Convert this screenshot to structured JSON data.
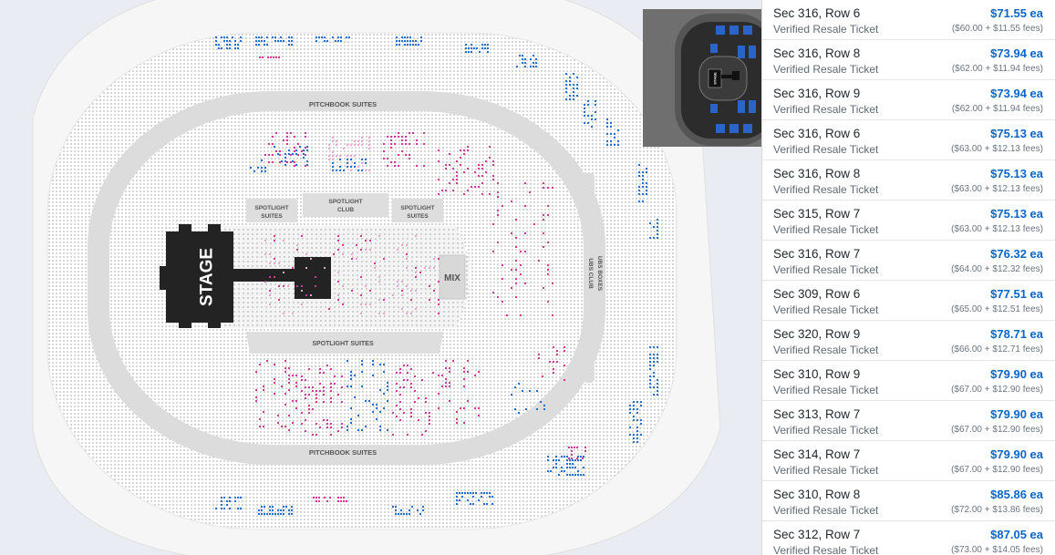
{
  "map": {
    "stage_label": "STAGE",
    "mix_label": "MIX",
    "pitchbook_top_label": "PITCHBOOK SUITES",
    "pitchbook_bottom_label": "PITCHBOOK SUITES",
    "spotlight_suites_left_label": [
      "SPOTLIGHT",
      "SUITES"
    ],
    "spotlight_club_label": [
      "SPOTLIGHT",
      "CLUB"
    ],
    "spotlight_suites_right_label": [
      "SPOTLIGHT",
      "SUITES"
    ],
    "spotlight_suites_bottom_label": "SPOTLIGHT SUITES",
    "ubs_club_label": [
      "UBS CLUB",
      "UBS BOXES"
    ],
    "colors": {
      "available_blue": "#1f6fd1",
      "available_pink": "#d2389a",
      "light_pink": "#e8a6cf",
      "seat_grey": "#c9c9c9",
      "suite_ring": "#d9d9d9",
      "stage": "#222222"
    }
  },
  "minimap": {
    "stage_label": "STAGE"
  },
  "listings": [
    {
      "title": "Sec 316, Row 6",
      "type": "Verified Resale Ticket",
      "price": "$71.55 ea",
      "fees": "($60.00 + $11.55 fees)"
    },
    {
      "title": "Sec 316, Row 8",
      "type": "Verified Resale Ticket",
      "price": "$73.94 ea",
      "fees": "($62.00 + $11.94 fees)"
    },
    {
      "title": "Sec 316, Row 9",
      "type": "Verified Resale Ticket",
      "price": "$73.94 ea",
      "fees": "($62.00 + $11.94 fees)"
    },
    {
      "title": "Sec 316, Row 6",
      "type": "Verified Resale Ticket",
      "price": "$75.13 ea",
      "fees": "($63.00 + $12.13 fees)"
    },
    {
      "title": "Sec 316, Row 8",
      "type": "Verified Resale Ticket",
      "price": "$75.13 ea",
      "fees": "($63.00 + $12.13 fees)"
    },
    {
      "title": "Sec 315, Row 7",
      "type": "Verified Resale Ticket",
      "price": "$75.13 ea",
      "fees": "($63.00 + $12.13 fees)"
    },
    {
      "title": "Sec 316, Row 7",
      "type": "Verified Resale Ticket",
      "price": "$76.32 ea",
      "fees": "($64.00 + $12.32 fees)"
    },
    {
      "title": "Sec 309, Row 6",
      "type": "Verified Resale Ticket",
      "price": "$77.51 ea",
      "fees": "($65.00 + $12.51 fees)"
    },
    {
      "title": "Sec 320, Row 9",
      "type": "Verified Resale Ticket",
      "price": "$78.71 ea",
      "fees": "($66.00 + $12.71 fees)"
    },
    {
      "title": "Sec 310, Row 9",
      "type": "Verified Resale Ticket",
      "price": "$79.90 ea",
      "fees": "($67.00 + $12.90 fees)"
    },
    {
      "title": "Sec 313, Row 7",
      "type": "Verified Resale Ticket",
      "price": "$79.90 ea",
      "fees": "($67.00 + $12.90 fees)"
    },
    {
      "title": "Sec 314, Row 7",
      "type": "Verified Resale Ticket",
      "price": "$79.90 ea",
      "fees": "($67.00 + $12.90 fees)"
    },
    {
      "title": "Sec 310, Row 8",
      "type": "Verified Resale Ticket",
      "price": "$85.86 ea",
      "fees": "($72.00 + $13.86 fees)"
    },
    {
      "title": "Sec 312, Row 7",
      "type": "Verified Resale Ticket",
      "price": "$87.05 ea",
      "fees": "($73.00 + $14.05 fees)"
    }
  ]
}
